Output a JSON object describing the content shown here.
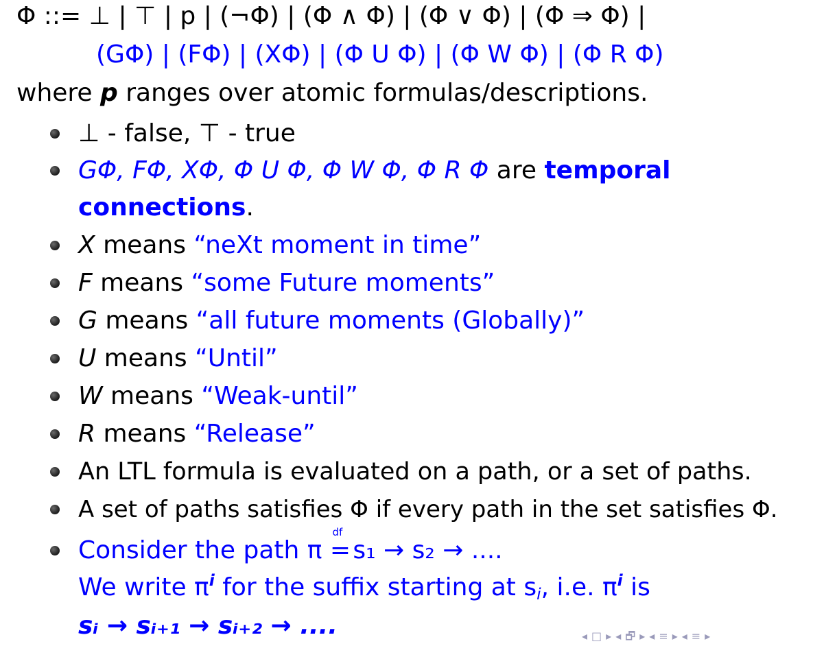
{
  "grammar": {
    "line1": "Φ ::= ⊥ | ⊤ | p | (¬Φ) | (Φ ∧ Φ) | (Φ ∨ Φ) | (Φ ⇒ Φ) |",
    "line2": "(GΦ) | (FΦ) | (XΦ) | (Φ U Φ) | (Φ W Φ) | (Φ R Φ)"
  },
  "where": {
    "pre": "where ",
    "var": "p",
    "post": " ranges over atomic formulas/descriptions."
  },
  "bullets": {
    "falsetrue": "⊥ - false, ⊤ - true",
    "temporal": {
      "formulas": "GΦ, FΦ, XΦ, Φ U Φ, Φ W Φ, Φ R Φ",
      "are": " are ",
      "term1": "temporal",
      "term2": "connections",
      "period": "."
    },
    "x": {
      "op": "X",
      "means": " means ",
      "desc": "“neXt moment in time”"
    },
    "f": {
      "op": "F",
      "means": " means ",
      "desc": "“some Future moments”"
    },
    "g": {
      "op": "G",
      "means": " means ",
      "desc": "“all future moments (Globally)”"
    },
    "u": {
      "op": "U",
      "means": " means ",
      "desc": "“Until”"
    },
    "w": {
      "op": "W",
      "means": " means ",
      "desc": "“Weak-until”"
    },
    "r": {
      "op": "R",
      "means": " means ",
      "desc": "“Release”"
    },
    "ltl": "An LTL formula is evaluated on a path, or a set of paths.",
    "sat": "A set of paths satisfies Φ if every path in the set satisfies Φ.",
    "path": {
      "consider": "Consider the path π ",
      "df": "df",
      "eq": "=",
      "seq": " s₁ → s₂ → ....",
      "write_pre": "We write π",
      "sup_i": "i",
      "write_mid": " for the suffix starting at s",
      "sub_i": "i",
      "write_ie": ", i.e. π",
      "sup_i2": "i",
      "write_is": " is",
      "suffix_seq": "sᵢ → sᵢ₊₁ → sᵢ₊₂ → ...."
    }
  },
  "nav": {
    "icons": [
      "◂",
      "□",
      "▸",
      "◂",
      "🗗",
      "▸",
      "◂",
      "≡",
      "▸",
      "◂",
      "≡",
      "▸"
    ]
  },
  "colors": {
    "accent": "#0000ff",
    "text": "#000000",
    "nav": "#9a9aba"
  }
}
